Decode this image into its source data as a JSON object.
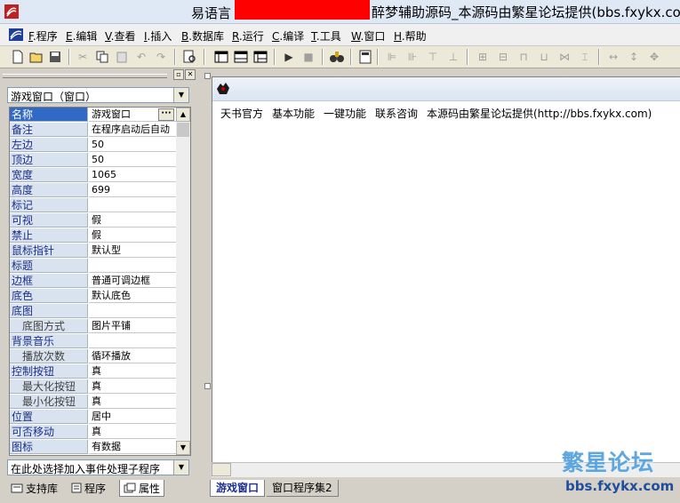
{
  "window": {
    "app_name": "易语言",
    "title_rest": "醉梦辅助源码_本源码由繁星论坛提供(bbs.fxykx.com"
  },
  "menu": [
    {
      "key": "F",
      "label": ".程序"
    },
    {
      "key": "E",
      "label": ".编辑"
    },
    {
      "key": "V",
      "label": ".查看"
    },
    {
      "key": "I",
      "label": ".插入"
    },
    {
      "key": "B",
      "label": ".数据库"
    },
    {
      "key": "R",
      "label": ".运行"
    },
    {
      "key": "C",
      "label": ".编译"
    },
    {
      "key": "T",
      "label": ".工具"
    },
    {
      "key": "W",
      "label": ".窗口"
    },
    {
      "key": "H",
      "label": ".帮助"
    }
  ],
  "left_panel": {
    "object_combo": "游戏窗口（窗口）",
    "event_combo": "在此处选择加入事件处理子程序",
    "tabs": [
      "支持库",
      "程序",
      "属性"
    ]
  },
  "properties": [
    {
      "name": "名称",
      "value": "游戏窗口",
      "selected": true
    },
    {
      "name": "备注",
      "value": "在程序启动后自动"
    },
    {
      "name": "左边",
      "value": "50"
    },
    {
      "name": "顶边",
      "value": "50"
    },
    {
      "name": "宽度",
      "value": "1065"
    },
    {
      "name": "高度",
      "value": "699"
    },
    {
      "name": "标记",
      "value": ""
    },
    {
      "name": "可视",
      "value": "假"
    },
    {
      "name": "禁止",
      "value": "假"
    },
    {
      "name": "鼠标指针",
      "value": "默认型"
    },
    {
      "name": "标题",
      "value": ""
    },
    {
      "name": "边框",
      "value": "普通可调边框"
    },
    {
      "name": "底色",
      "value": "默认底色"
    },
    {
      "name": "底图",
      "value": ""
    },
    {
      "name": "底图方式",
      "value": "图片平铺",
      "sub": true
    },
    {
      "name": "背景音乐",
      "value": ""
    },
    {
      "name": "播放次数",
      "value": "循环播放",
      "sub": true
    },
    {
      "name": "控制按钮",
      "value": "真"
    },
    {
      "name": "最大化按钮",
      "value": "真",
      "sub": true
    },
    {
      "name": "最小化按钮",
      "value": "真",
      "sub": true
    },
    {
      "name": "位置",
      "value": "居中"
    },
    {
      "name": "可否移动",
      "value": "真"
    },
    {
      "name": "图标",
      "value": "有数据"
    }
  ],
  "form": {
    "menu": [
      "天书官方",
      "基本功能",
      "一键功能",
      "联系咨询",
      "本源码由繁星论坛提供(http://bbs.fxykx.com)"
    ]
  },
  "editor_tabs": [
    "游戏窗口",
    "窗口程序集2"
  ],
  "watermark": {
    "main": "繁星论坛",
    "sub": "bbs.fxykx.com"
  },
  "colors": {
    "selected": "#316ac5",
    "prop_name_bg": "#d8e3ef",
    "title_redaction": "#ff0000",
    "watermark_blue": "#5fa6de"
  }
}
